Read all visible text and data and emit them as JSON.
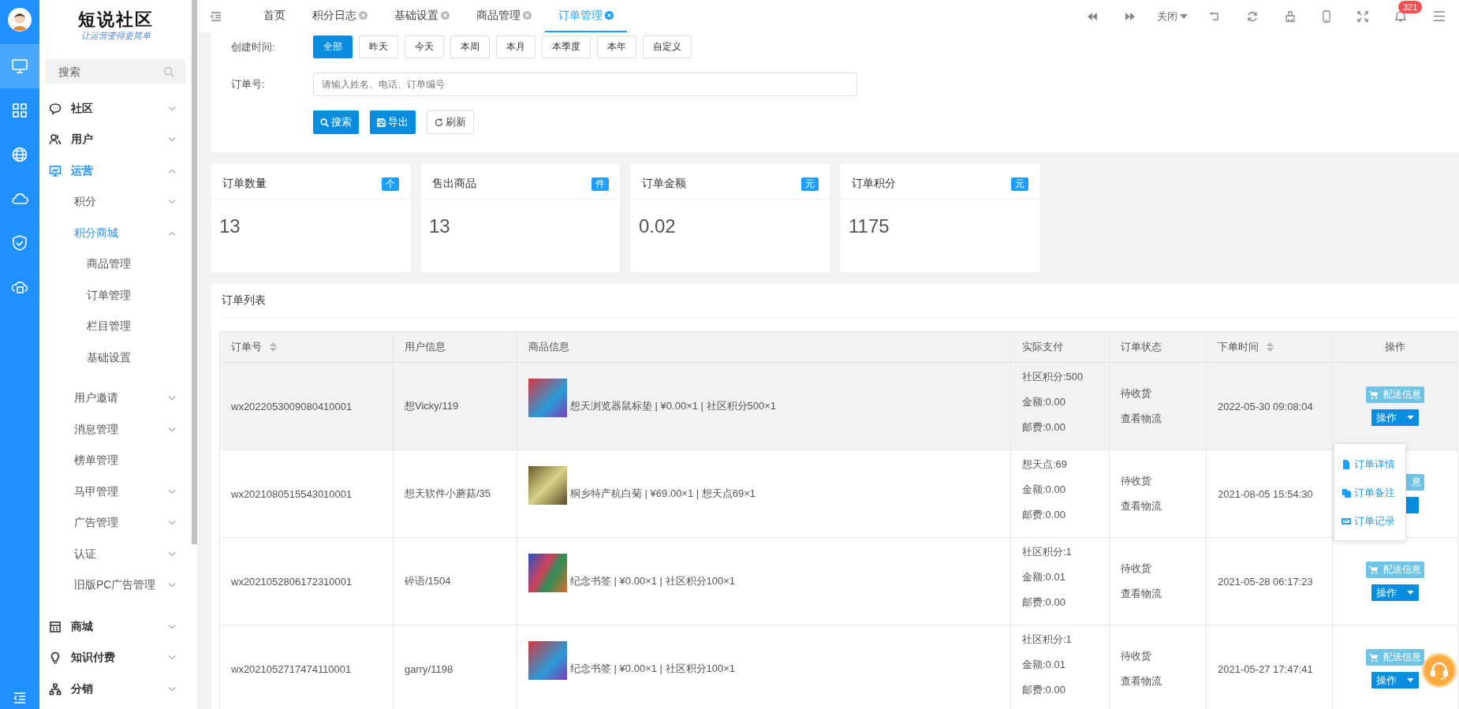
{
  "rail": {
    "items": [
      {
        "kind": "monitor",
        "selected": true
      },
      {
        "kind": "grid",
        "selected": false
      },
      {
        "kind": "globe",
        "selected": false
      },
      {
        "kind": "cloud",
        "selected": false
      },
      {
        "kind": "shield",
        "selected": false
      },
      {
        "kind": "cloud-device",
        "selected": false
      }
    ]
  },
  "sidebar": {
    "logo": "短说社区",
    "slogan": "让运营变得更简单",
    "search": {
      "placeholder": "搜索"
    },
    "menu": [
      {
        "label": "社区",
        "kind": "chat",
        "expanded": false,
        "selected": false
      },
      {
        "label": "用户",
        "kind": "users",
        "expanded": false,
        "selected": false
      },
      {
        "label": "运营",
        "kind": "presentation",
        "expanded": true,
        "selected": true,
        "children": [
          {
            "label": "积分",
            "expanded": false,
            "selected": false
          },
          {
            "label": "积分商城",
            "expanded": true,
            "selected": true,
            "children": [
              {
                "label": "商品管理",
                "selected": false
              },
              {
                "label": "订单管理",
                "selected": false
              },
              {
                "label": "栏目管理",
                "selected": false
              },
              {
                "label": "基础设置",
                "selected": false
              }
            ]
          },
          {
            "label": "用户邀请",
            "expanded": false,
            "selected": false
          },
          {
            "label": "消息管理",
            "expanded": false,
            "selected": false
          },
          {
            "label": "榜单管理",
            "selected": false
          },
          {
            "label": "马甲管理",
            "expanded": false,
            "selected": false
          },
          {
            "label": "广告管理",
            "expanded": false,
            "selected": false
          },
          {
            "label": "认证",
            "expanded": false,
            "selected": false
          },
          {
            "label": "旧版PC广告管理",
            "expanded": false,
            "selected": false
          }
        ]
      },
      {
        "label": "商城",
        "kind": "store",
        "expanded": false,
        "selected": false
      },
      {
        "label": "知识付费",
        "kind": "bulb",
        "expanded": false,
        "selected": false
      },
      {
        "label": "分销",
        "kind": "org",
        "expanded": false,
        "selected": false
      }
    ]
  },
  "tabs": [
    {
      "label": "首页",
      "closable": false,
      "selected": false
    },
    {
      "label": "积分日志",
      "closable": true,
      "selected": false
    },
    {
      "label": "基础设置",
      "closable": true,
      "selected": false
    },
    {
      "label": "商品管理",
      "closable": true,
      "selected": false
    },
    {
      "label": "订单管理",
      "closable": true,
      "selected": true
    }
  ],
  "toolbar": {
    "close_menu": "关闭",
    "notification_count": "321"
  },
  "filter": {
    "time_label": "创建时间:",
    "ranges": [
      {
        "label": "全部",
        "selected": true
      },
      {
        "label": "昨天",
        "selected": false
      },
      {
        "label": "今天",
        "selected": false
      },
      {
        "label": "本周",
        "selected": false
      },
      {
        "label": "本月",
        "selected": false
      },
      {
        "label": "本季度",
        "selected": false
      },
      {
        "label": "本年",
        "selected": false
      },
      {
        "label": "自定义",
        "selected": false
      }
    ],
    "order_label": "订单号:",
    "order_placeholder": "请输入姓名、电话、订单编号",
    "buttons": [
      {
        "label": "搜索",
        "kind": "search"
      },
      {
        "label": "导出",
        "kind": "export"
      },
      {
        "label": "刷新",
        "kind": "refresh"
      }
    ]
  },
  "stats": [
    {
      "title": "订单数量",
      "unit": "个",
      "value": "13"
    },
    {
      "title": "售出商品",
      "unit": "件",
      "value": "13"
    },
    {
      "title": "订单金额",
      "unit": "元",
      "value": "0.02"
    },
    {
      "title": "订单积分",
      "unit": "元",
      "value": "1175"
    }
  ],
  "order_list": {
    "title": "订单列表",
    "columns": [
      {
        "label": "订单号",
        "sortable": true
      },
      {
        "label": "用户信息",
        "sortable": false
      },
      {
        "label": "商品信息",
        "sortable": false
      },
      {
        "label": "实际支付",
        "sortable": false
      },
      {
        "label": "订单状态",
        "sortable": false
      },
      {
        "label": "下单时间",
        "sortable": true
      },
      {
        "label": "操作",
        "sortable": false
      }
    ],
    "rows": [
      {
        "order_no": "wx2022053009080410001",
        "user": "想Vicky/119",
        "product": "想天浏览器鼠标垫 | ¥0.00×1 | 社区积分500×1",
        "payment": [
          "社区积分:500",
          "金额:0.00",
          "邮费:0.00"
        ],
        "status": "待收货",
        "logistics": "查看物流",
        "time": "2022-05-30 09:08:04",
        "ship_button": "配送信息",
        "action_button": "操作",
        "selected": true,
        "menu_open": true
      },
      {
        "order_no": "wx2021080515543010001",
        "user": "想天软件小蘑菇/35",
        "product": "桐乡特产杭白菊 | ¥69.00×1 | 想天点69×1",
        "payment": [
          "想天点:69",
          "金额:0.00",
          "邮费:0.00"
        ],
        "status": "待收货",
        "logistics": "查看物流",
        "time": "2021-08-05 15:54:30",
        "ship_button": "息",
        "selected": false,
        "menu_open": false
      },
      {
        "order_no": "wx2021052806172310001",
        "user": "碎语/1504",
        "product": "纪念书签 | ¥0.00×1 | 社区积分100×1",
        "payment": [
          "社区积分:1",
          "金额:0.01",
          "邮费:0.00"
        ],
        "status": "待收货",
        "logistics": "查看物流",
        "time": "2021-05-28 06:17:23",
        "ship_button": "配送信息",
        "action_button": "操作",
        "selected": false,
        "menu_open": false
      },
      {
        "order_no": "wx2021052717474110001",
        "user": "garry/1198",
        "product": "纪念书签 | ¥0.00×1 | 社区积分100×1",
        "payment": [
          "社区积分:1",
          "金额:0.01",
          "邮费:0.00"
        ],
        "status": "待收货",
        "logistics": "查看物流",
        "time": "2021-05-27 17:47:41",
        "ship_button": "配送信息",
        "action_button": "操作",
        "selected": false,
        "menu_open": false
      }
    ],
    "action_menu": [
      {
        "label": "订单详情",
        "kind": "detail"
      },
      {
        "label": "订单备注",
        "kind": "note"
      },
      {
        "label": "订单记录",
        "kind": "log"
      }
    ]
  }
}
